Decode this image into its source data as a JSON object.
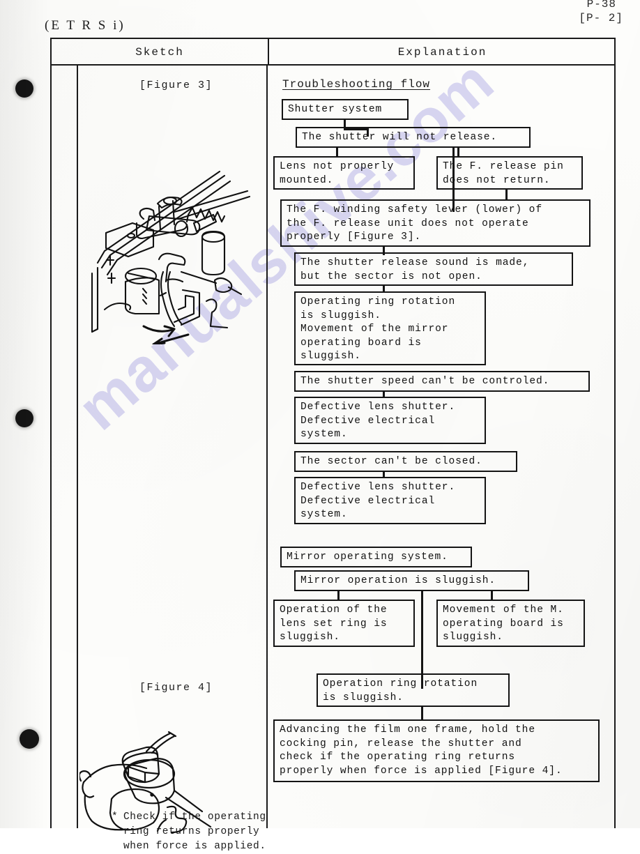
{
  "header": {
    "model_code": "(E T R S i)",
    "page_top": "P-38",
    "page_sub": "[P- 2]"
  },
  "watermark": "manualshive.com",
  "table": {
    "columns": [
      {
        "key": "sketch",
        "label": "Sketch"
      },
      {
        "key": "explanation",
        "label": "Explanation"
      }
    ]
  },
  "sketch": {
    "figure3_label": "[Figure 3]",
    "figure4_label": "[Figure 4]",
    "note_bullet": "*",
    "note_text": "Check if the operating\nring returns properly\nwhen force is applied."
  },
  "explanation": {
    "flow_title": "Troubleshooting flow",
    "boxes": [
      {
        "id": "shutter-system",
        "text": "Shutter system"
      },
      {
        "id": "shutter-not-release",
        "text": "The shutter will not release."
      },
      {
        "id": "lens-not-mounted",
        "text": "Lens not properly\nmounted."
      },
      {
        "id": "release-pin-no-return",
        "text": "The F. release pin\ndoes not return."
      },
      {
        "id": "winding-safety-lever",
        "text": "The F. winding safety lever (lower) of\nthe F. release unit does not operate\nproperly [Figure 3]."
      },
      {
        "id": "release-sound-no-sector",
        "text": "The shutter release sound is made,\nbut the sector is not open."
      },
      {
        "id": "operating-ring-sluggish",
        "text": "Operating ring rotation\nis sluggish.\nMovement of the mirror\noperating board is\nsluggish."
      },
      {
        "id": "speed-not-controled",
        "text": "The shutter speed can't be controled."
      },
      {
        "id": "defective-lens-1",
        "text": "Defective lens shutter.\nDefective electrical\nsystem."
      },
      {
        "id": "sector-not-closed",
        "text": "The sector can't be closed."
      },
      {
        "id": "defective-lens-2",
        "text": "Defective lens shutter.\nDefective electrical\nsystem."
      },
      {
        "id": "mirror-operating-system",
        "text": "Mirror operating system."
      },
      {
        "id": "mirror-op-sluggish",
        "text": "Mirror operation is sluggish."
      },
      {
        "id": "lens-set-ring",
        "text": "Operation of the\nlens set ring is\nsluggish."
      },
      {
        "id": "m-operating-board",
        "text": "Movement of the M.\noperating board is\nsluggish."
      },
      {
        "id": "operation-ring-rot",
        "text": "Operation ring rotation\nis sluggish."
      },
      {
        "id": "advancing-film",
        "text": "Advancing the film one frame, hold the\ncocking pin, release the shutter and\ncheck if the operating ring returns\nproperly when force is applied [Figure 4]."
      }
    ]
  }
}
